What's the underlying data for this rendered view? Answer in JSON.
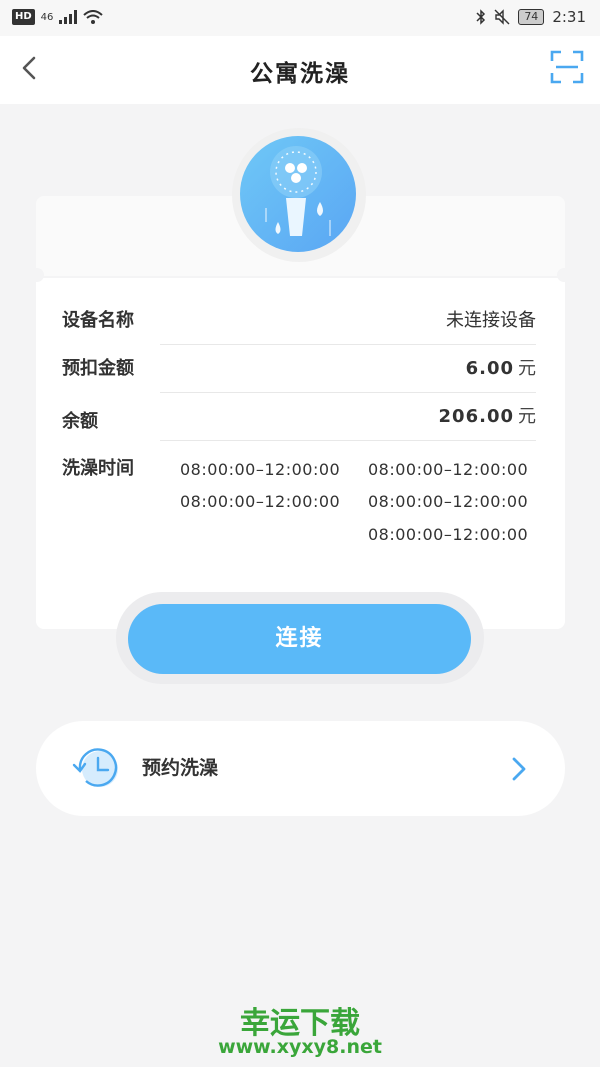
{
  "status_bar": {
    "left_badge": "HD",
    "signal": "46",
    "battery": "74",
    "time": "2:31"
  },
  "header": {
    "title": "公寓洗澡"
  },
  "device": {
    "name_label": "设备名称",
    "name_value": "未连接设备",
    "deposit_label": "预扣金额",
    "deposit_value": "6.00",
    "balance_label": "余额",
    "balance_value": "206.00",
    "currency": "元",
    "time_label": "洗澡时间",
    "time_slots": [
      "08:00:00–12:00:00",
      "08:00:00–12:00:00",
      "08:00:00–12:00:00",
      "08:00:00–12:00:00",
      "08:00:00–12:00:00"
    ]
  },
  "connect_button": "连接",
  "reservation": {
    "label": "预约洗澡"
  },
  "watermark": {
    "title": "幸运下载",
    "url": "www.xyxy8.net"
  },
  "colors": {
    "accent": "#5ab9f8",
    "watermark": "#3aa63a"
  },
  "icons": {
    "back": "chevron-left-icon",
    "scan": "scan-icon",
    "shower": "shower-icon",
    "clock": "clock-history-icon",
    "arrow": "chevron-right-icon"
  }
}
